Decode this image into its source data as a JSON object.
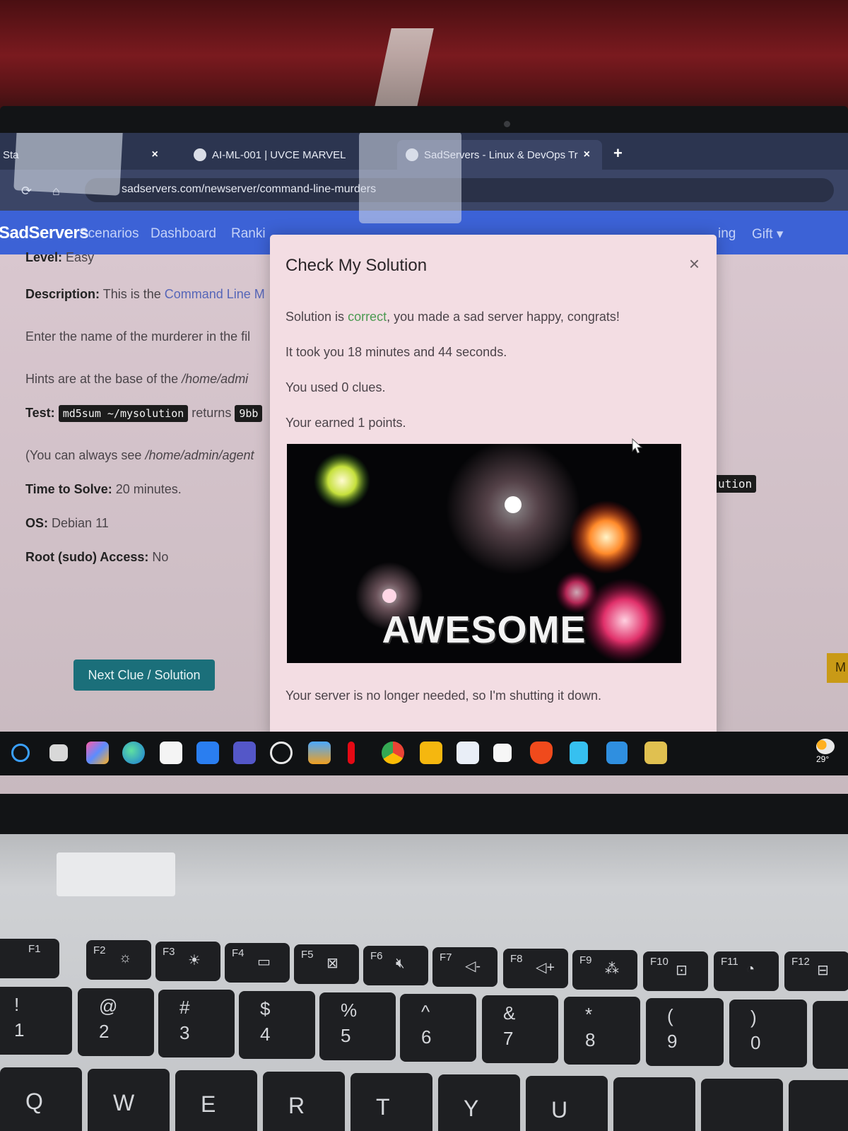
{
  "browser": {
    "tabs": [
      {
        "label": "Sta",
        "close": "×"
      },
      {
        "label": "AI-ML-001 | UVCE MARVEL",
        "close": "×"
      },
      {
        "label": "SadServers - Linux & DevOps Tr",
        "close": "×"
      }
    ],
    "new_tab": "+",
    "url": "sadservers.com/newserver/command-line-murders"
  },
  "site_nav": {
    "brand": "SadServers",
    "links": [
      "Scenarios",
      "Dashboard",
      "Ranki"
    ],
    "right_links": [
      "ing",
      "Gift"
    ]
  },
  "scenario": {
    "level_label": "Level:",
    "level_value": "Easy",
    "description_label": "Description:",
    "description_text": "This is the ",
    "description_link": "Command Line M",
    "enter_text": "Enter the name of the murderer in the fil",
    "hints_text": "Hints are at the base of the ",
    "hints_path": "/home/admi",
    "test_label": "Test:",
    "test_command": "md5sum ~/mysolution",
    "test_returns": "returns",
    "test_hash": "9bb",
    "see_text": "(You can always see ",
    "see_path": "/home/admin/agent",
    "time_label": "Time to Solve:",
    "time_value": "20 minutes.",
    "os_label": "OS:",
    "os_value": "Debian 11",
    "root_label": "Root (sudo) Access:",
    "root_value": "No",
    "solution_tag": "ution",
    "next_button": "Next Clue / Solution",
    "side_button": "M"
  },
  "modal": {
    "title": "Check My Solution",
    "close": "×",
    "result_prefix": "Solution is ",
    "result_word": "correct",
    "result_suffix": ", you made a sad server happy, congrats!",
    "time_line": "It took you 18 minutes and 44 seconds.",
    "clues_line": "You used 0 clues.",
    "points_line": "Your earned 1 points.",
    "gif_text": "AWESOME",
    "footer": "Your server is no longer needed, so I'm shutting it down."
  },
  "taskbar": {
    "weather_temp": "29°",
    "icons": [
      "search-icon",
      "task-view-icon",
      "copilot-icon",
      "edge-icon",
      "store-icon",
      "quick-assist-icon",
      "teams-icon",
      "chatgpt-icon",
      "photos-icon",
      "netflix-icon",
      "chrome-icon",
      "file-explorer-icon",
      "whiteboard-icon",
      "notion-icon",
      "brave-icon",
      "notepad-icon",
      "vscode-icon",
      "slack-icon"
    ]
  },
  "keyboard": {
    "fn_row": [
      "F1",
      "F2",
      "F3",
      "F4",
      "F5",
      "F6",
      "F7",
      "F8",
      "F9",
      "F10",
      "F11",
      "F12"
    ],
    "num_row": [
      {
        "top": "!",
        "bottom": "1"
      },
      {
        "top": "@",
        "bottom": "2"
      },
      {
        "top": "#",
        "bottom": "3"
      },
      {
        "top": "$",
        "bottom": "4"
      },
      {
        "top": "%",
        "bottom": "5"
      },
      {
        "top": "^",
        "bottom": "6"
      },
      {
        "top": "&",
        "bottom": "7"
      },
      {
        "top": "*",
        "bottom": "8"
      },
      {
        "top": "(",
        "bottom": "9"
      },
      {
        "top": ")",
        "bottom": "0"
      }
    ],
    "letter_row": [
      "Q",
      "W",
      "E",
      "R",
      "T",
      "Y",
      "U"
    ]
  }
}
